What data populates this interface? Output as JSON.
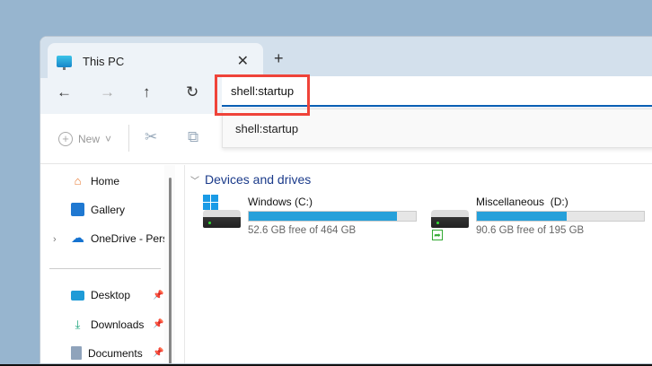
{
  "tab": {
    "title": "This PC",
    "close": "✕",
    "new_tab": "+"
  },
  "nav": {
    "back": "←",
    "forward": "→",
    "up": "↑",
    "refresh": "↻"
  },
  "address": {
    "value": "shell:startup",
    "suggestion": "shell:startup"
  },
  "command": {
    "new_label": "New",
    "new_chevron": "˅"
  },
  "sidebar": {
    "items": [
      {
        "label": "Home"
      },
      {
        "label": "Gallery"
      },
      {
        "label": "OneDrive - Perso"
      },
      {
        "label": "Desktop"
      },
      {
        "label": "Downloads"
      },
      {
        "label": "Documents"
      }
    ]
  },
  "main": {
    "section": "Devices and drives",
    "drives": [
      {
        "name": "Windows (C:)",
        "free": "52.6 GB free of 464 GB",
        "used_fraction": 0.887
      },
      {
        "name": "Miscellaneous  (D:)",
        "free": "90.6 GB free of 195 GB",
        "used_fraction": 0.535
      }
    ]
  }
}
